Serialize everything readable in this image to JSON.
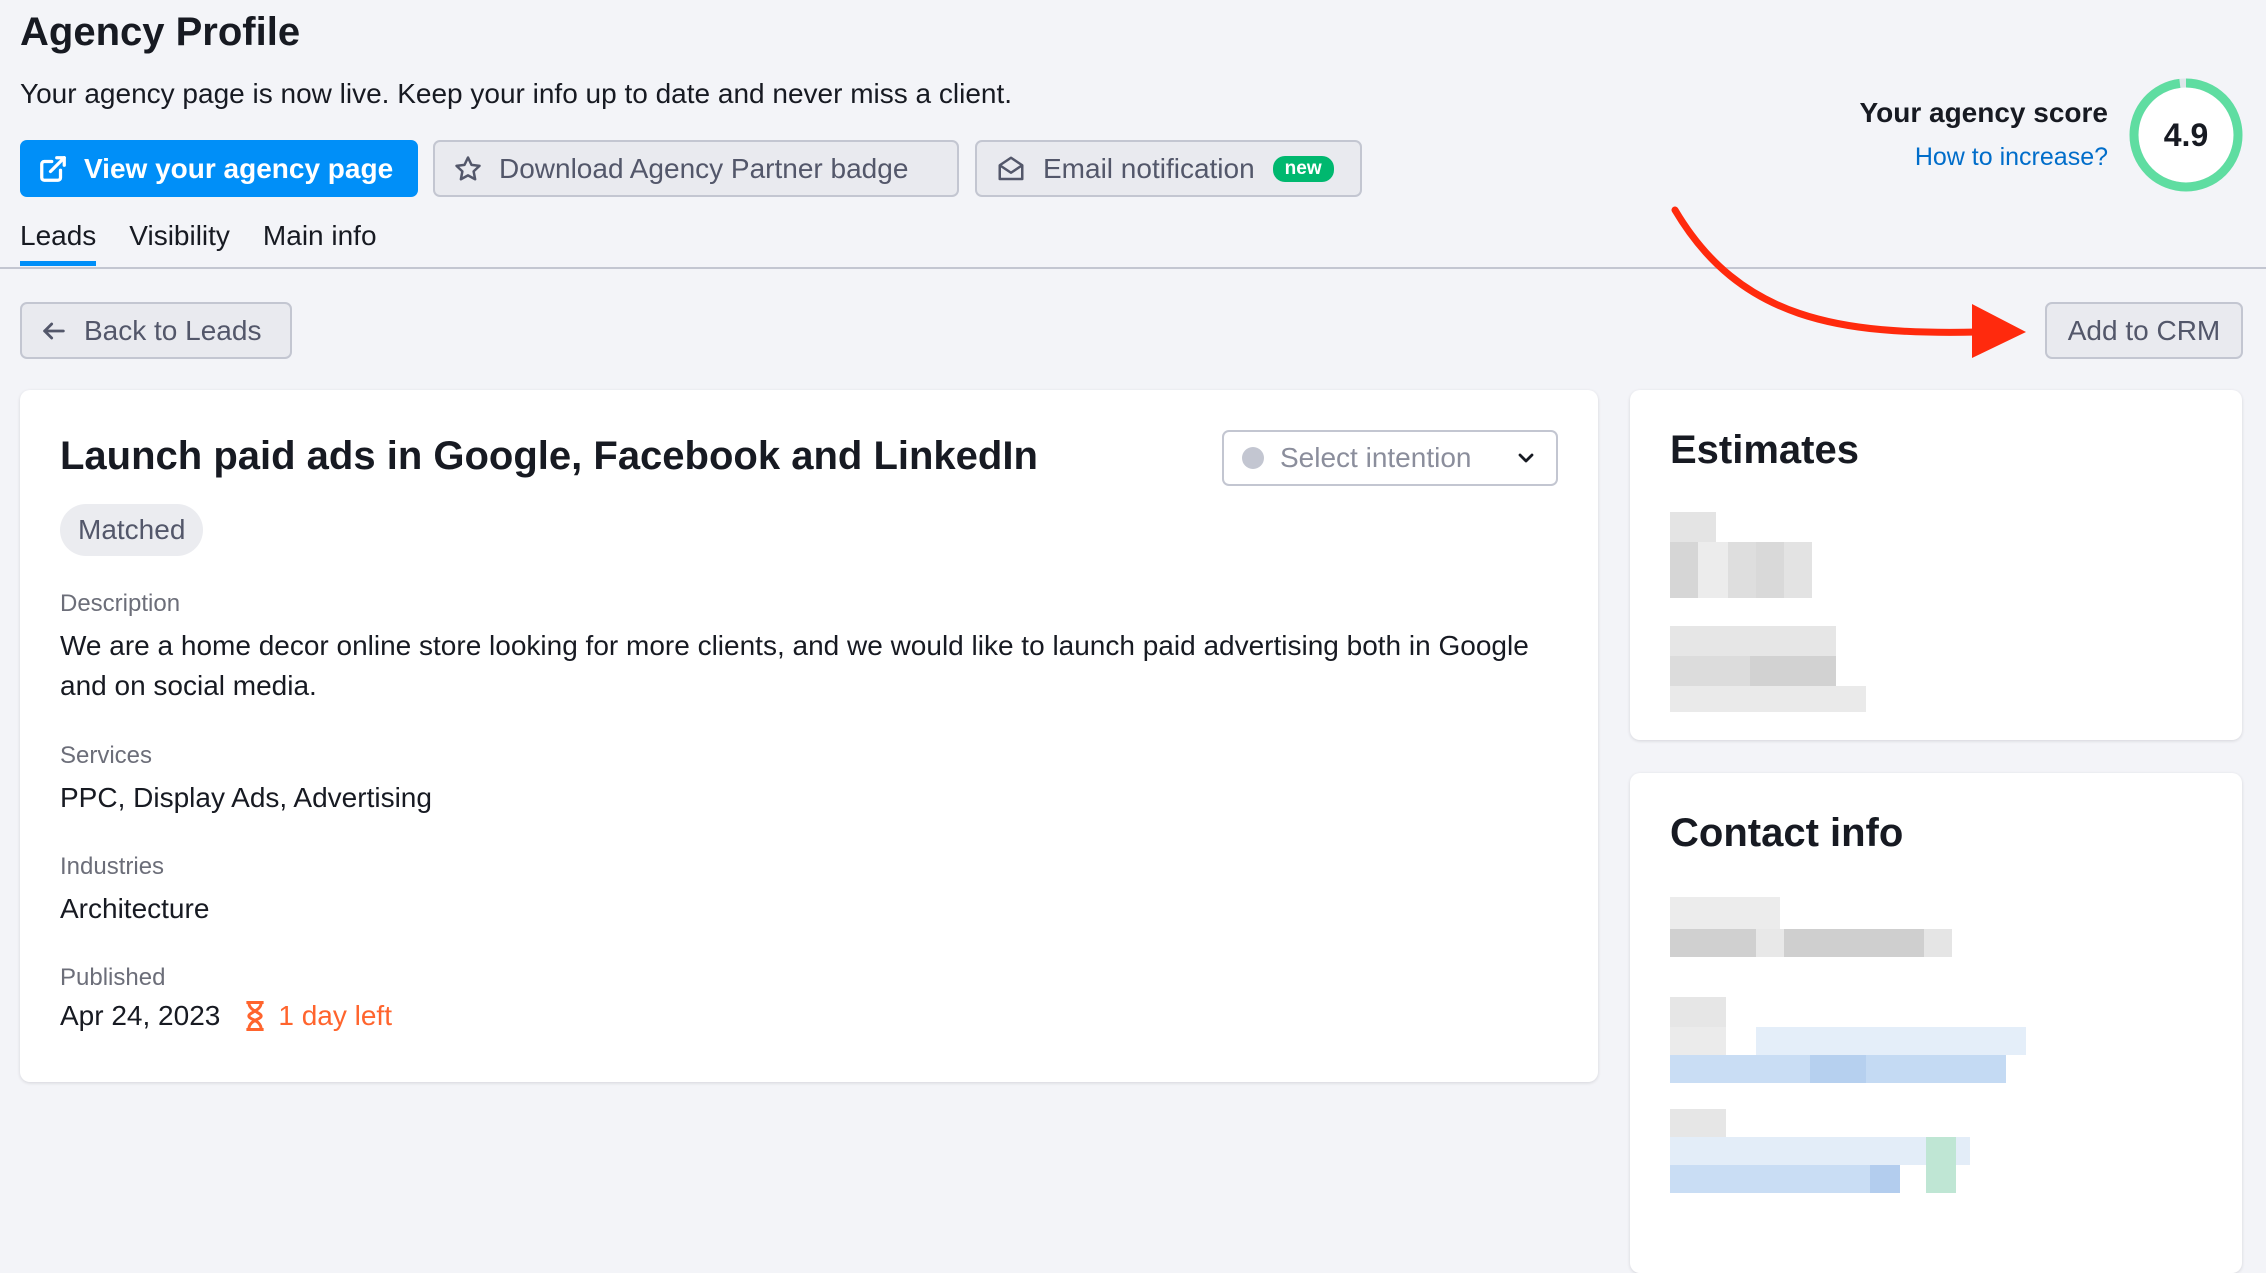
{
  "header": {
    "title": "Agency Profile",
    "subtitle": "Your agency page is now live. Keep your info up to date and never miss a client.",
    "view_page_label": "View your agency page",
    "download_badge_label": "Download Agency Partner badge",
    "email_notification_label": "Email notification",
    "new_tag": "new"
  },
  "score": {
    "title": "Your agency score",
    "link": "How to increase?",
    "value": "4.9",
    "fraction": 0.98
  },
  "tabs": [
    {
      "label": "Leads",
      "active": true
    },
    {
      "label": "Visibility",
      "active": false
    },
    {
      "label": "Main info",
      "active": false
    }
  ],
  "toolbar": {
    "back_label": "Back to Leads",
    "crm_label": "Add to CRM"
  },
  "lead": {
    "title": "Launch paid ads in Google, Facebook and LinkedIn",
    "intention_placeholder": "Select intention",
    "status": "Matched",
    "description_label": "Description",
    "description": "We are a home decor online store looking for more clients, and we would like to launch paid advertising both in Google and on social media.",
    "services_label": "Services",
    "services": "PPC, Display Ads, Advertising",
    "industries_label": "Industries",
    "industries": "Architecture",
    "published_label": "Published",
    "published": "Apr 24, 2023",
    "days_left": "1 day left"
  },
  "estimates": {
    "title": "Estimates"
  },
  "contact": {
    "title": "Contact info"
  },
  "colors": {
    "primary": "#008ff8",
    "link": "#006dca",
    "success": "#00b86f",
    "warning": "#ff642d",
    "annotation_arrow": "#ff2a0d"
  }
}
